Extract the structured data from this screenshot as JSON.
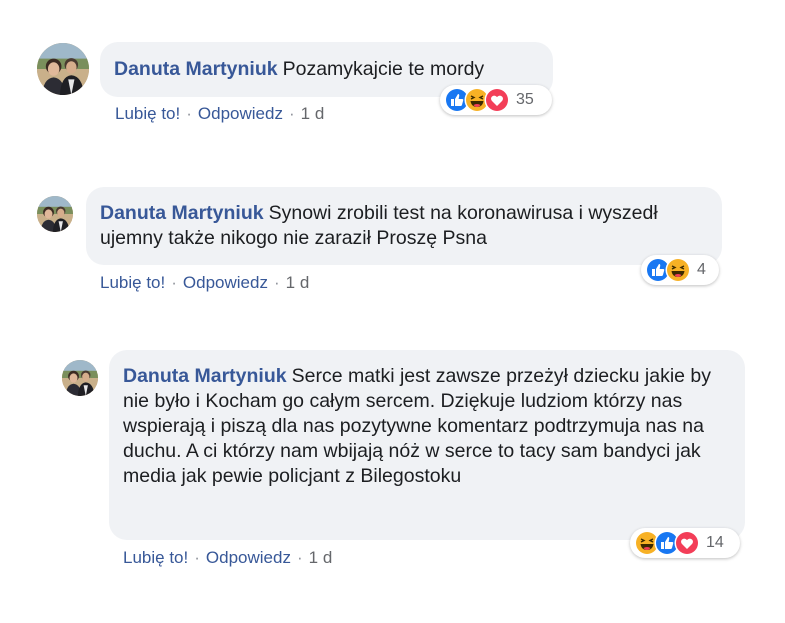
{
  "colors": {
    "author": "#385898",
    "bubble": "#f0f2f5",
    "like": "#1877f2",
    "love": "#f33e58",
    "haha": "#f7b125"
  },
  "comments": [
    {
      "author": "Danuta Martyniuk",
      "text": "Pozamykajcie te mordy",
      "like_label": "Lubię to!",
      "reply_label": "Odpowiedz",
      "separator": "·",
      "time": "1 d",
      "reactions": [
        "like-icon",
        "haha-icon",
        "love-icon"
      ],
      "reaction_count": "35"
    },
    {
      "author": "Danuta Martyniuk",
      "text": "Synowi zrobili test na koronawirusa i wyszedł ujemny także nikogo nie zaraził Proszę Psna",
      "like_label": "Lubię to!",
      "reply_label": "Odpowiedz",
      "separator": "·",
      "time": "1 d",
      "reactions": [
        "like-icon",
        "haha-icon"
      ],
      "reaction_count": "4"
    },
    {
      "author": "Danuta Martyniuk",
      "text": "Serce matki jest zawsze przeżył dziecku jakie by nie było i Kocham go całym sercem. Dziękuje ludziom którzy nas wspierają i piszą dla nas pozytywne komentarz podtrzymuja nas na duchu. A ci którzy nam wbijają nóż w serce to tacy sam bandyci jak media jak pewie policjant z Bilegostoku",
      "like_label": "Lubię to!",
      "reply_label": "Odpowiedz",
      "separator": "·",
      "time": "1 d",
      "reactions": [
        "haha-icon",
        "like-icon",
        "love-icon"
      ],
      "reaction_count": "14"
    }
  ]
}
